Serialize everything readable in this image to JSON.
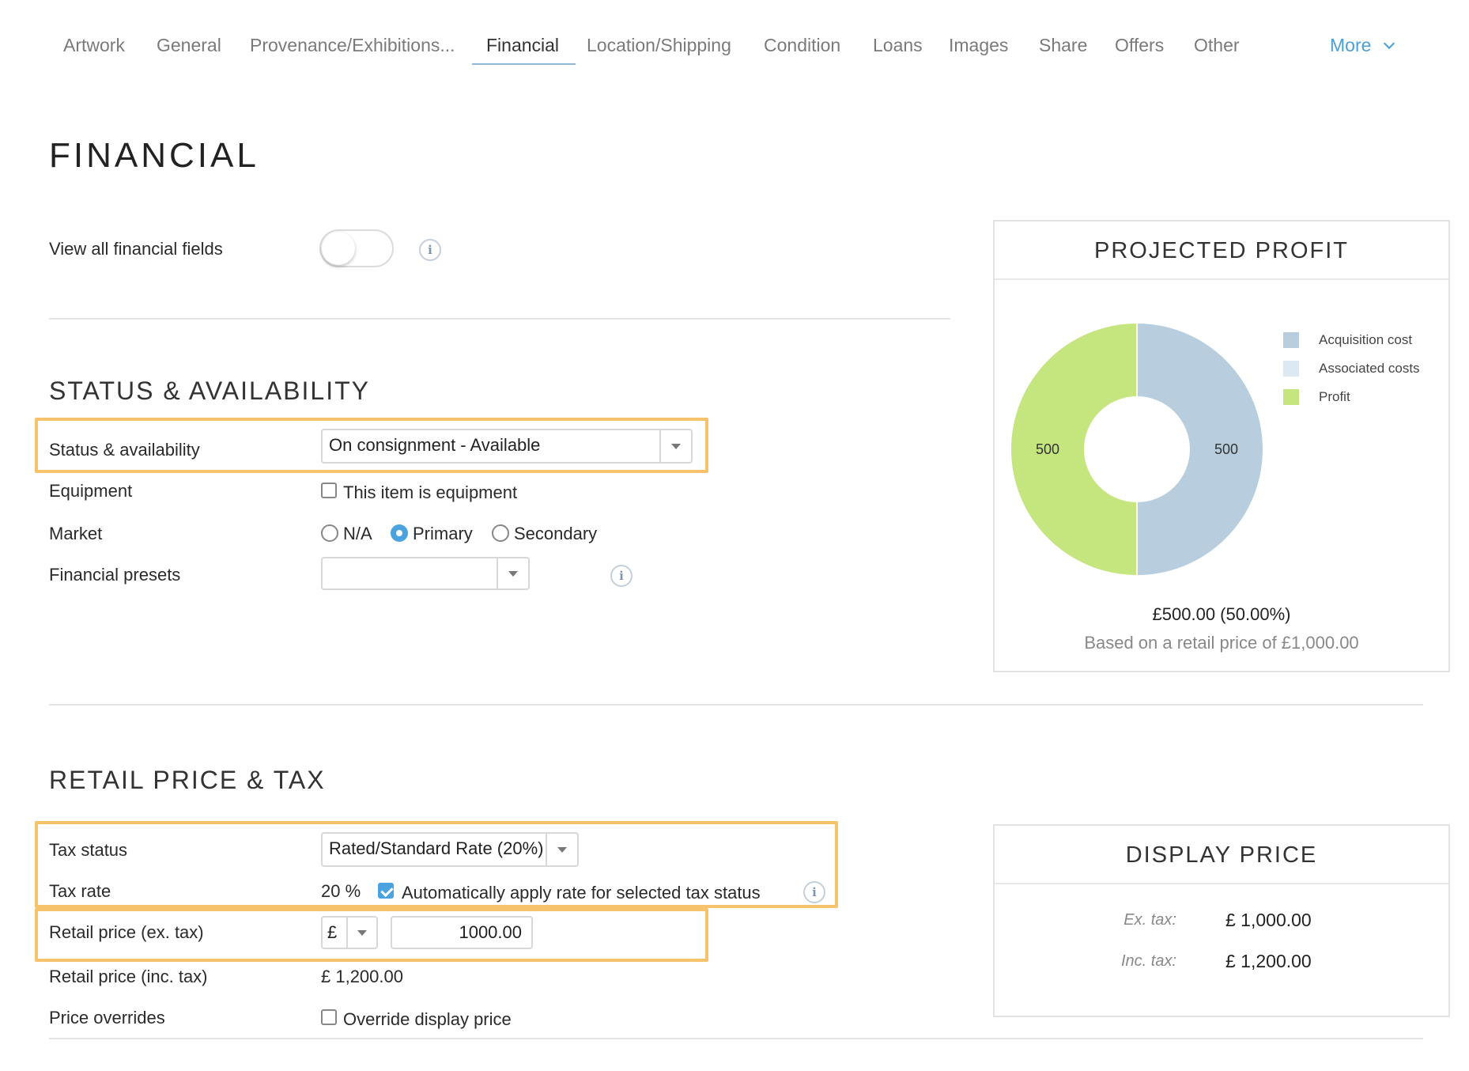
{
  "tabs": [
    {
      "label": "Artwork"
    },
    {
      "label": "General"
    },
    {
      "label": "Provenance/Exhibitions..."
    },
    {
      "label": "Financial"
    },
    {
      "label": "Location/Shipping"
    },
    {
      "label": "Condition"
    },
    {
      "label": "Loans"
    },
    {
      "label": "Images"
    },
    {
      "label": "Share"
    },
    {
      "label": "Offers"
    },
    {
      "label": "Other"
    }
  ],
  "active_tab": "Financial",
  "more_label": "More",
  "page_title": "FINANCIAL",
  "view_all": {
    "label": "View all financial fields",
    "enabled": false
  },
  "status_section": {
    "title": "STATUS & AVAILABILITY",
    "status_label": "Status & availability",
    "status_value": "On consignment - Available",
    "equipment_label": "Equipment",
    "equipment_checkbox_label": "This item is equipment",
    "equipment_checked": false,
    "market_label": "Market",
    "market_options": [
      {
        "label": "N/A",
        "selected": false
      },
      {
        "label": "Primary",
        "selected": true
      },
      {
        "label": "Secondary",
        "selected": false
      }
    ],
    "presets_label": "Financial presets",
    "presets_value": ""
  },
  "retail_section": {
    "title": "RETAIL PRICE & TAX",
    "tax_status_label": "Tax status",
    "tax_status_value": "Rated/Standard Rate (20%)",
    "tax_rate_label": "Tax rate",
    "tax_rate_value": "20 %",
    "auto_apply_label": "Automatically apply rate for selected tax status",
    "auto_apply_checked": true,
    "retail_ex_label": "Retail price (ex. tax)",
    "currency": "£",
    "retail_ex_value": "1000.00",
    "retail_inc_label": "Retail price (inc. tax)",
    "retail_inc_value": "£ 1,200.00",
    "overrides_label": "Price overrides",
    "override_checkbox_label": "Override display price",
    "override_checked": false
  },
  "projected_profit": {
    "title": "PROJECTED PROFIT",
    "summary": "£500.00 (50.00%)",
    "note": "Based on a retail price of £1,000.00"
  },
  "chart_data": {
    "type": "pie",
    "style": "donut",
    "legend_position": "top-right",
    "series": [
      {
        "name": "Acquisition cost",
        "value": 500,
        "color": "#b8cede",
        "label": "500"
      },
      {
        "name": "Associated costs",
        "value": 0,
        "color": "#dce8f2",
        "label": ""
      },
      {
        "name": "Profit",
        "value": 500,
        "color": "#c5e67f",
        "label": "500"
      }
    ]
  },
  "display_price": {
    "title": "DISPLAY PRICE",
    "ex_label": "Ex. tax:",
    "ex_value": "£ 1,000.00",
    "inc_label": "Inc. tax:",
    "inc_value": "£ 1,200.00"
  },
  "colors": {
    "accent": "#4aa3df",
    "highlight": "#f6c26b"
  }
}
